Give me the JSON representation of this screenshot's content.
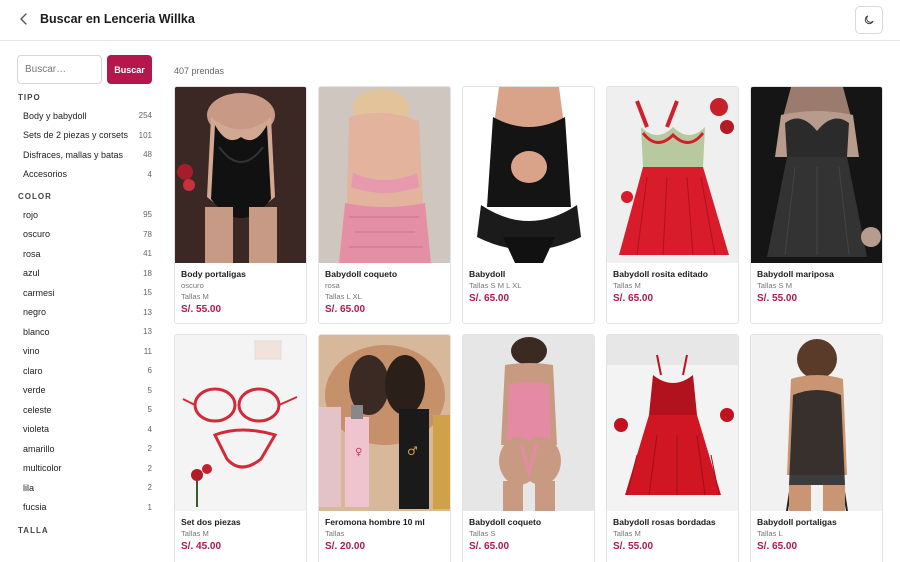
{
  "header": {
    "title": "Buscar en Lenceria Willka"
  },
  "search": {
    "placeholder": "Buscar…",
    "button_label": "Buscar"
  },
  "facets": {
    "tipo": {
      "title": "TIPO",
      "items": [
        {
          "label": "Body y babydoll",
          "count": "254"
        },
        {
          "label": "Sets de 2 piezas y corsets",
          "count": "101"
        },
        {
          "label": "Disfraces, mallas y batas",
          "count": "48"
        },
        {
          "label": "Accesorios",
          "count": "4"
        }
      ]
    },
    "color": {
      "title": "COLOR",
      "items": [
        {
          "label": "rojo",
          "count": "95"
        },
        {
          "label": "oscuro",
          "count": "78"
        },
        {
          "label": "rosa",
          "count": "41"
        },
        {
          "label": "azul",
          "count": "18"
        },
        {
          "label": "carmesi",
          "count": "15"
        },
        {
          "label": "negro",
          "count": "13"
        },
        {
          "label": "blanco",
          "count": "13"
        },
        {
          "label": "vino",
          "count": "11"
        },
        {
          "label": "claro",
          "count": "6"
        },
        {
          "label": "verde",
          "count": "5"
        },
        {
          "label": "celeste",
          "count": "5"
        },
        {
          "label": "violeta",
          "count": "4"
        },
        {
          "label": "amarillo",
          "count": "2"
        },
        {
          "label": "multicolor",
          "count": "2"
        },
        {
          "label": "lila",
          "count": "2"
        },
        {
          "label": "fucsia",
          "count": "1"
        }
      ]
    },
    "talla": {
      "title": "TALLA"
    }
  },
  "results": {
    "count_label": "407 prendas"
  },
  "products": [
    {
      "name": "Body portaligas",
      "color": "oscuro",
      "sizes": "Tallas M",
      "price": "S/. 55.00"
    },
    {
      "name": "Babydoll coqueto",
      "color": "rosa",
      "sizes": "Tallas L XL",
      "price": "S/. 65.00"
    },
    {
      "name": "Babydoll",
      "color": "",
      "sizes": "Tallas S M L XL",
      "price": "S/. 65.00"
    },
    {
      "name": "Babydoll rosita editado",
      "color": "",
      "sizes": "Tallas M",
      "price": "S/. 65.00"
    },
    {
      "name": "Babydoll mariposa",
      "color": "",
      "sizes": "Tallas S M",
      "price": "S/. 55.00"
    },
    {
      "name": "Set dos piezas",
      "color": "",
      "sizes": "Tallas M",
      "price": "S/. 45.00"
    },
    {
      "name": "Feromona hombre 10 ml",
      "color": "",
      "sizes": "Tallas",
      "price": "S/. 20.00"
    },
    {
      "name": "Babydoll coqueto",
      "color": "",
      "sizes": "Tallas S",
      "price": "S/. 65.00"
    },
    {
      "name": "Babydoll rosas bordadas",
      "color": "",
      "sizes": "Tallas M",
      "price": "S/. 55.00"
    },
    {
      "name": "Babydoll portaligas",
      "color": "",
      "sizes": "Tallas L",
      "price": "S/. 65.00"
    }
  ],
  "colors": {
    "accent": "#b3174c",
    "border": "#e3e3e3"
  },
  "icons": {
    "back": "chevron-left-icon",
    "theme": "moon-icon"
  }
}
